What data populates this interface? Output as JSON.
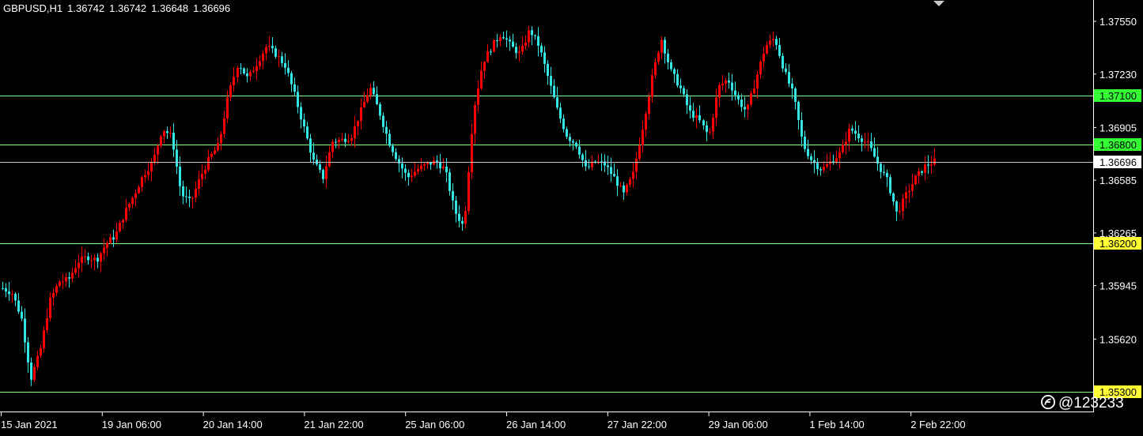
{
  "header": {
    "symbol": "GBPUSD,H1",
    "open": "1.36742",
    "high": "1.36742",
    "low": "1.36648",
    "close": "1.36696"
  },
  "watermark": {
    "text": "@123233",
    "icon": "weibo-logo-icon"
  },
  "colors": {
    "background": "#000000",
    "bull": "#ff0000",
    "bear": "#33e5e5",
    "level_line": "#7cff7c",
    "axis": "#ffffff",
    "price_badge": "#ffffff",
    "level_badge_green": "#33ff33",
    "level_badge_yellow": "#ffff33"
  },
  "chart_data": {
    "type": "candlestick",
    "symbol": "GBPUSD",
    "timeframe": "H1",
    "ylim": [
      1.3518,
      1.3768
    ],
    "y_ticks": [
      "1.37550",
      "1.37230",
      "1.36905",
      "1.36585",
      "1.36265",
      "1.35945",
      "1.35620"
    ],
    "x_ticks": [
      "15 Jan 2021",
      "19 Jan 06:00",
      "20 Jan 14:00",
      "21 Jan 22:00",
      "25 Jan 06:00",
      "26 Jan 14:00",
      "27 Jan 22:00",
      "29 Jan 06:00",
      "1 Feb 14:00",
      "2 Feb 22:00"
    ],
    "levels": [
      {
        "price": 1.371,
        "label": "1.37100",
        "badge": "green"
      },
      {
        "price": 1.368,
        "label": "1.36800",
        "badge": "green"
      },
      {
        "price": 1.362,
        "label": "1.36200",
        "badge": "yellow"
      },
      {
        "price": 1.353,
        "label": "1.35300",
        "badge": "yellow"
      }
    ],
    "last_price": {
      "price": 1.36696,
      "label": "1.36696"
    },
    "path": [
      1.3593,
      1.359,
      1.3575,
      1.3538,
      1.3555,
      1.3585,
      1.3597,
      1.3598,
      1.3609,
      1.3612,
      1.361,
      1.362,
      1.3625,
      1.3639,
      1.365,
      1.3662,
      1.367,
      1.369,
      1.3685,
      1.365,
      1.3645,
      1.366,
      1.3672,
      1.368,
      1.371,
      1.373,
      1.372,
      1.373,
      1.374,
      1.3735,
      1.3728,
      1.371,
      1.369,
      1.367,
      1.366,
      1.3682,
      1.3683,
      1.3685,
      1.37,
      1.3715,
      1.37,
      1.3682,
      1.367,
      1.366,
      1.3665,
      1.3668,
      1.367,
      1.3665,
      1.364,
      1.363,
      1.37,
      1.373,
      1.374,
      1.3748,
      1.374,
      1.3735,
      1.375,
      1.374,
      1.372,
      1.37,
      1.3685,
      1.368,
      1.3665,
      1.367,
      1.3668,
      1.366,
      1.365,
      1.3662,
      1.369,
      1.372,
      1.3745,
      1.3725,
      1.3715,
      1.37,
      1.3695,
      1.3685,
      1.3715,
      1.372,
      1.3708,
      1.37,
      1.372,
      1.374,
      1.3745,
      1.3725,
      1.371,
      1.368,
      1.367,
      1.3665,
      1.367,
      1.3675,
      1.369,
      1.3685,
      1.368,
      1.3668,
      1.3658,
      1.3638,
      1.365,
      1.366,
      1.3667,
      1.367
    ]
  }
}
